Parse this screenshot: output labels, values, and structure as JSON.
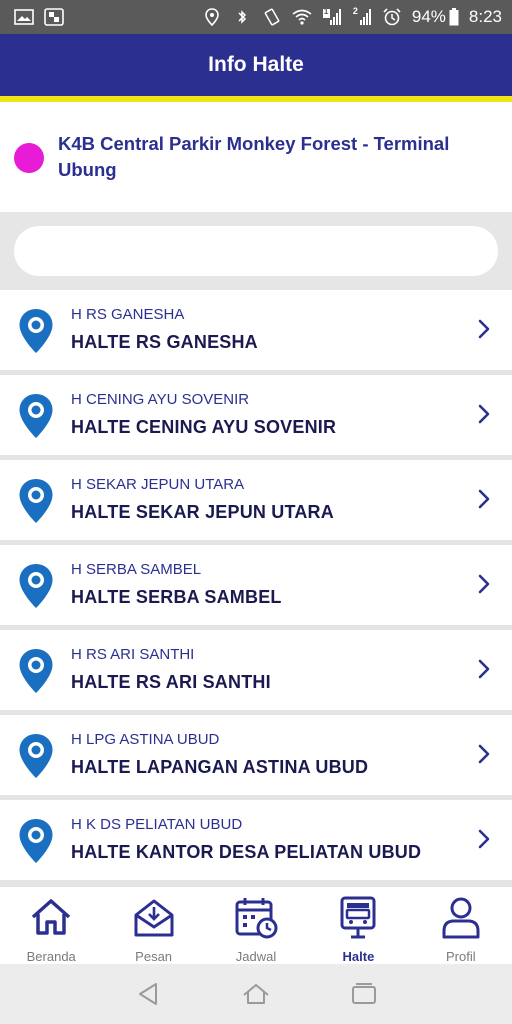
{
  "status_bar": {
    "battery": "94%",
    "time": "8:23",
    "sim1_badge": "1",
    "sim2_badge": "2"
  },
  "header": {
    "title": "Info Halte"
  },
  "route": {
    "name": "K4B Central Parkir Monkey Forest - Terminal Ubung",
    "color": "#e81bd6"
  },
  "search": {
    "value": "",
    "placeholder": ""
  },
  "stops": [
    {
      "code": "H RS GANESHA",
      "name": "HALTE RS GANESHA"
    },
    {
      "code": "H CENING AYU SOVENIR",
      "name": "HALTE CENING AYU SOVENIR"
    },
    {
      "code": "H SEKAR JEPUN UTARA",
      "name": "HALTE SEKAR JEPUN UTARA"
    },
    {
      "code": "H SERBA SAMBEL",
      "name": "HALTE SERBA SAMBEL"
    },
    {
      "code": "H RS ARI SANTHI",
      "name": "HALTE RS ARI SANTHI"
    },
    {
      "code": "H LPG ASTINA UBUD",
      "name": "HALTE LAPANGAN ASTINA UBUD"
    },
    {
      "code": "H K DS PELIATAN UBUD",
      "name": "HALTE KANTOR DESA PELIATAN UBUD"
    }
  ],
  "bottom_nav": [
    {
      "label": "Beranda",
      "icon": "home-icon",
      "active": false
    },
    {
      "label": "Pesan",
      "icon": "inbox-icon",
      "active": false
    },
    {
      "label": "Jadwal",
      "icon": "calendar-clock-icon",
      "active": false
    },
    {
      "label": "Halte",
      "icon": "bus-stop-icon",
      "active": true
    },
    {
      "label": "Profil",
      "icon": "user-icon",
      "active": false
    }
  ],
  "colors": {
    "primary": "#2b3090",
    "accent_stripe": "#f2e411",
    "pin": "#1a6fc0"
  }
}
